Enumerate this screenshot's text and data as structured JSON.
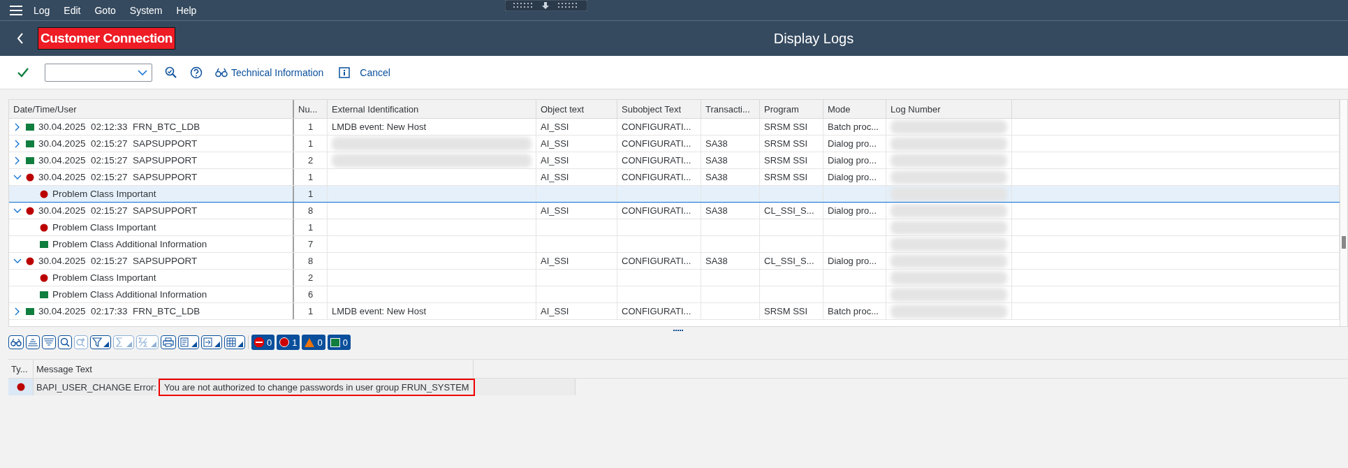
{
  "menu": [
    "Log",
    "Edit",
    "Goto",
    "System",
    "Help"
  ],
  "shell": {
    "app_title": "Customer Connection",
    "page_title": "Display Logs"
  },
  "toolbar": {
    "buttons": [
      {
        "kind": "tech",
        "label": "Technical Information"
      },
      {
        "kind": "cancel",
        "label": "Cancel"
      }
    ]
  },
  "table": {
    "columns": [
      "Date/Time/User",
      "Nu...",
      "External Identification",
      "Object text",
      "Subobject Text",
      "Transacti...",
      "Program",
      "Mode",
      "Log Number"
    ],
    "rows": [
      {
        "kind": "log",
        "expanded": false,
        "error": false,
        "text": "30.04.2025  02:12:33  FRN_BTC_LDB",
        "number": "1",
        "external_id": "LMDB event: New Host",
        "object_text": "AI_SSI",
        "subobject_text": "CONFIGURATI...",
        "program": "SRSM SSI",
        "mode": "Batch proc...",
        "selected": false
      },
      {
        "kind": "log",
        "expanded": false,
        "error": false,
        "text": "30.04.2025  02:15:27  SAPSUPPORT",
        "number": "1",
        "redacted": true,
        "object_text": "AI_SSI",
        "subobject_text": "CONFIGURATI...",
        "transaction": "SA38",
        "program": "SRSM SSI",
        "mode": "Dialog pro...",
        "selected": false
      },
      {
        "kind": "log",
        "expanded": false,
        "error": false,
        "text": "30.04.2025  02:15:27  SAPSUPPORT",
        "number": "2",
        "redacted": true,
        "object_text": "AI_SSI",
        "subobject_text": "CONFIGURATI...",
        "transaction": "SA38",
        "program": "SRSM SSI",
        "mode": "Dialog pro...",
        "selected": false
      },
      {
        "kind": "log",
        "expanded": true,
        "error": true,
        "text": "30.04.2025  02:15:27  SAPSUPPORT",
        "number": "1",
        "object_text": "AI_SSI",
        "subobject_text": "CONFIGURATI...",
        "transaction": "SA38",
        "program": "SRSM SSI",
        "mode": "Dialog pro...",
        "selected": false
      },
      {
        "kind": "class",
        "error": true,
        "text": "Problem Class Important",
        "number": "1",
        "selected": true
      },
      {
        "kind": "log",
        "expanded": true,
        "error": true,
        "text": "30.04.2025  02:15:27  SAPSUPPORT",
        "number": "8",
        "object_text": "AI_SSI",
        "subobject_text": "CONFIGURATI...",
        "transaction": "SA38",
        "program": "CL_SSI_S...",
        "mode": "Dialog pro...",
        "selected": false
      },
      {
        "kind": "class",
        "error": true,
        "text": "Problem Class Important",
        "number": "1",
        "selected": false
      },
      {
        "kind": "class",
        "error": false,
        "text": "Problem Class Additional Information",
        "number": "7",
        "selected": false
      },
      {
        "kind": "log",
        "expanded": true,
        "error": true,
        "text": "30.04.2025  02:15:27  SAPSUPPORT",
        "number": "8",
        "object_text": "AI_SSI",
        "subobject_text": "CONFIGURATI...",
        "transaction": "SA38",
        "program": "CL_SSI_S...",
        "mode": "Dialog pro...",
        "selected": false
      },
      {
        "kind": "class",
        "error": true,
        "text": "Problem Class Important",
        "number": "2",
        "selected": false
      },
      {
        "kind": "class",
        "error": false,
        "text": "Problem Class Additional Information",
        "number": "6",
        "selected": false
      },
      {
        "kind": "log",
        "expanded": false,
        "error": false,
        "text": "30.04.2025  02:17:33  FRN_BTC_LDB",
        "number": "1",
        "external_id": "LMDB event: New Host",
        "object_text": "AI_SSI",
        "subobject_text": "CONFIGURATI...",
        "program": "SRSM SSI",
        "mode": "Batch proc...",
        "selected": false
      }
    ]
  },
  "counters": [
    {
      "kind": "stop",
      "count": "0"
    },
    {
      "kind": "error",
      "count": "1"
    },
    {
      "kind": "warning",
      "count": "0"
    },
    {
      "kind": "success",
      "count": "0"
    }
  ],
  "messages": {
    "columns": [
      "Ty...",
      "Message Text"
    ],
    "rows": [
      {
        "error": true,
        "prefix": "BAPI_USER_CHANGE Error:",
        "text": "You are not authorized to change passwords in user group FRUN_SYSTEM",
        "highlighted": true
      }
    ]
  }
}
